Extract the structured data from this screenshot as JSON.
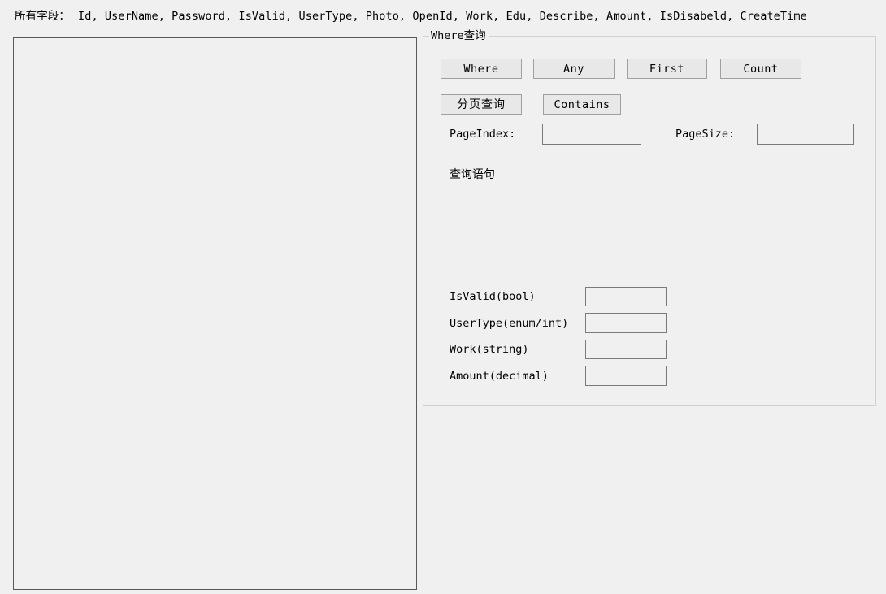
{
  "header": {
    "all_fields_label": "所有字段：",
    "all_fields_value": "Id, UserName, Password, IsValid, UserType, Photo, OpenId, Work, Edu, Describe, Amount, IsDisabeld, CreateTime"
  },
  "result_panel": {
    "content": ""
  },
  "where_group": {
    "title_en": "Where",
    "title_cn": "查询",
    "buttons": {
      "where": "Where",
      "any": "Any",
      "first": "First",
      "count": "Count",
      "paging": "分页查询",
      "contains": "Contains"
    },
    "paging": {
      "page_index_label": "PageIndex:",
      "page_index_value": "",
      "page_size_label": "PageSize:",
      "page_size_value": ""
    },
    "sql": {
      "label": "查询语句",
      "output": ""
    },
    "fields": [
      {
        "label": "IsValid(bool)",
        "value": ""
      },
      {
        "label": "UserType(enum/int)",
        "value": ""
      },
      {
        "label": "Work(string)",
        "value": ""
      },
      {
        "label": "Amount(decimal)",
        "value": ""
      }
    ]
  },
  "colors": {
    "window_background": "#f0f0f0",
    "panel_border": "#595959",
    "group_border": "#d0d0d0",
    "button_face": "#e8e8e8",
    "button_border": "#a0a0a0",
    "textbox_border": "#7a7a7a",
    "text": "#000000"
  }
}
